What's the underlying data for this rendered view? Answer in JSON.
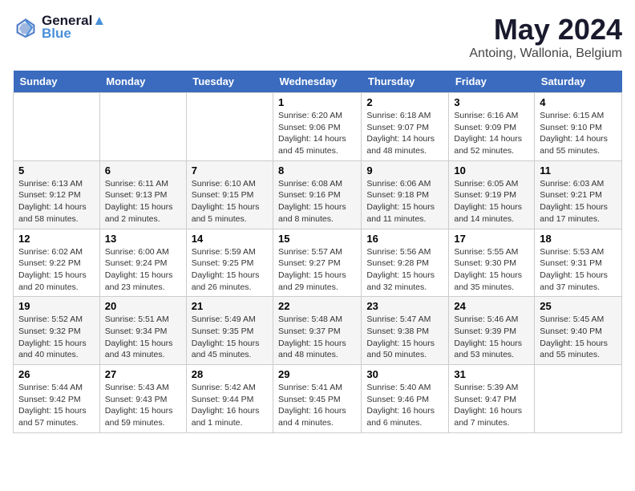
{
  "header": {
    "logo_line1": "General",
    "logo_line2": "Blue",
    "month_title": "May 2024",
    "location": "Antoing, Wallonia, Belgium"
  },
  "weekdays": [
    "Sunday",
    "Monday",
    "Tuesday",
    "Wednesday",
    "Thursday",
    "Friday",
    "Saturday"
  ],
  "weeks": [
    [
      {
        "day": "",
        "info": ""
      },
      {
        "day": "",
        "info": ""
      },
      {
        "day": "",
        "info": ""
      },
      {
        "day": "1",
        "info": "Sunrise: 6:20 AM\nSunset: 9:06 PM\nDaylight: 14 hours\nand 45 minutes."
      },
      {
        "day": "2",
        "info": "Sunrise: 6:18 AM\nSunset: 9:07 PM\nDaylight: 14 hours\nand 48 minutes."
      },
      {
        "day": "3",
        "info": "Sunrise: 6:16 AM\nSunset: 9:09 PM\nDaylight: 14 hours\nand 52 minutes."
      },
      {
        "day": "4",
        "info": "Sunrise: 6:15 AM\nSunset: 9:10 PM\nDaylight: 14 hours\nand 55 minutes."
      }
    ],
    [
      {
        "day": "5",
        "info": "Sunrise: 6:13 AM\nSunset: 9:12 PM\nDaylight: 14 hours\nand 58 minutes."
      },
      {
        "day": "6",
        "info": "Sunrise: 6:11 AM\nSunset: 9:13 PM\nDaylight: 15 hours\nand 2 minutes."
      },
      {
        "day": "7",
        "info": "Sunrise: 6:10 AM\nSunset: 9:15 PM\nDaylight: 15 hours\nand 5 minutes."
      },
      {
        "day": "8",
        "info": "Sunrise: 6:08 AM\nSunset: 9:16 PM\nDaylight: 15 hours\nand 8 minutes."
      },
      {
        "day": "9",
        "info": "Sunrise: 6:06 AM\nSunset: 9:18 PM\nDaylight: 15 hours\nand 11 minutes."
      },
      {
        "day": "10",
        "info": "Sunrise: 6:05 AM\nSunset: 9:19 PM\nDaylight: 15 hours\nand 14 minutes."
      },
      {
        "day": "11",
        "info": "Sunrise: 6:03 AM\nSunset: 9:21 PM\nDaylight: 15 hours\nand 17 minutes."
      }
    ],
    [
      {
        "day": "12",
        "info": "Sunrise: 6:02 AM\nSunset: 9:22 PM\nDaylight: 15 hours\nand 20 minutes."
      },
      {
        "day": "13",
        "info": "Sunrise: 6:00 AM\nSunset: 9:24 PM\nDaylight: 15 hours\nand 23 minutes."
      },
      {
        "day": "14",
        "info": "Sunrise: 5:59 AM\nSunset: 9:25 PM\nDaylight: 15 hours\nand 26 minutes."
      },
      {
        "day": "15",
        "info": "Sunrise: 5:57 AM\nSunset: 9:27 PM\nDaylight: 15 hours\nand 29 minutes."
      },
      {
        "day": "16",
        "info": "Sunrise: 5:56 AM\nSunset: 9:28 PM\nDaylight: 15 hours\nand 32 minutes."
      },
      {
        "day": "17",
        "info": "Sunrise: 5:55 AM\nSunset: 9:30 PM\nDaylight: 15 hours\nand 35 minutes."
      },
      {
        "day": "18",
        "info": "Sunrise: 5:53 AM\nSunset: 9:31 PM\nDaylight: 15 hours\nand 37 minutes."
      }
    ],
    [
      {
        "day": "19",
        "info": "Sunrise: 5:52 AM\nSunset: 9:32 PM\nDaylight: 15 hours\nand 40 minutes."
      },
      {
        "day": "20",
        "info": "Sunrise: 5:51 AM\nSunset: 9:34 PM\nDaylight: 15 hours\nand 43 minutes."
      },
      {
        "day": "21",
        "info": "Sunrise: 5:49 AM\nSunset: 9:35 PM\nDaylight: 15 hours\nand 45 minutes."
      },
      {
        "day": "22",
        "info": "Sunrise: 5:48 AM\nSunset: 9:37 PM\nDaylight: 15 hours\nand 48 minutes."
      },
      {
        "day": "23",
        "info": "Sunrise: 5:47 AM\nSunset: 9:38 PM\nDaylight: 15 hours\nand 50 minutes."
      },
      {
        "day": "24",
        "info": "Sunrise: 5:46 AM\nSunset: 9:39 PM\nDaylight: 15 hours\nand 53 minutes."
      },
      {
        "day": "25",
        "info": "Sunrise: 5:45 AM\nSunset: 9:40 PM\nDaylight: 15 hours\nand 55 minutes."
      }
    ],
    [
      {
        "day": "26",
        "info": "Sunrise: 5:44 AM\nSunset: 9:42 PM\nDaylight: 15 hours\nand 57 minutes."
      },
      {
        "day": "27",
        "info": "Sunrise: 5:43 AM\nSunset: 9:43 PM\nDaylight: 15 hours\nand 59 minutes."
      },
      {
        "day": "28",
        "info": "Sunrise: 5:42 AM\nSunset: 9:44 PM\nDaylight: 16 hours\nand 1 minute."
      },
      {
        "day": "29",
        "info": "Sunrise: 5:41 AM\nSunset: 9:45 PM\nDaylight: 16 hours\nand 4 minutes."
      },
      {
        "day": "30",
        "info": "Sunrise: 5:40 AM\nSunset: 9:46 PM\nDaylight: 16 hours\nand 6 minutes."
      },
      {
        "day": "31",
        "info": "Sunrise: 5:39 AM\nSunset: 9:47 PM\nDaylight: 16 hours\nand 7 minutes."
      },
      {
        "day": "",
        "info": ""
      }
    ]
  ]
}
